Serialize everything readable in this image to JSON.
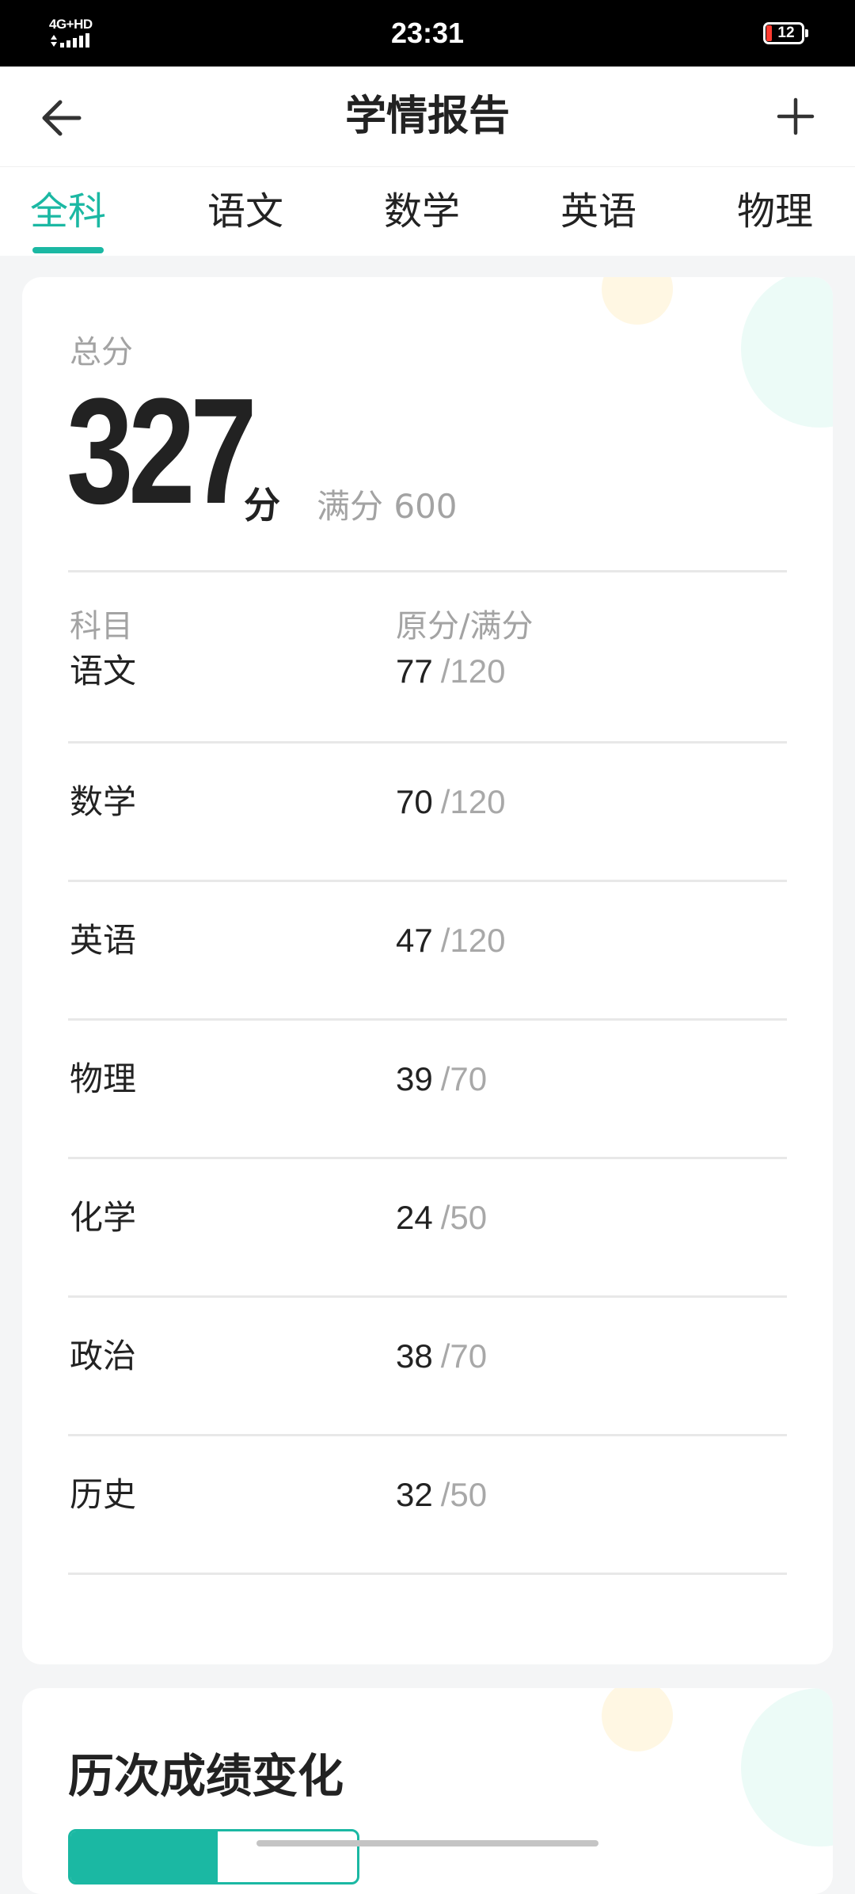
{
  "status_bar": {
    "network": "4G+HD",
    "time": "23:31",
    "battery": "12",
    "battery_color": "#ff3b30"
  },
  "header": {
    "title": "学情报告",
    "back_icon": "arrow-left-icon",
    "add_icon": "plus-icon"
  },
  "tabs": [
    {
      "label": "全科",
      "active": true
    },
    {
      "label": "语文",
      "active": false
    },
    {
      "label": "数学",
      "active": false
    },
    {
      "label": "英语",
      "active": false
    },
    {
      "label": "物理",
      "active": false
    }
  ],
  "accent_color": "#1bb8a3",
  "score_card": {
    "total_label": "总分",
    "total_score": "327",
    "total_unit": "分",
    "full_mark_label": "满分 600",
    "col_subject": "科目",
    "col_score": "原分/满分",
    "subjects": [
      {
        "name": "语文",
        "score": "77",
        "full": "/120"
      },
      {
        "name": "数学",
        "score": "70",
        "full": "/120"
      },
      {
        "name": "英语",
        "score": "47",
        "full": "/120"
      },
      {
        "name": "物理",
        "score": "39",
        "full": "/70"
      },
      {
        "name": "化学",
        "score": "24",
        "full": "/50"
      },
      {
        "name": "政治",
        "score": "38",
        "full": "/70"
      },
      {
        "name": "历史",
        "score": "32",
        "full": "/50"
      }
    ]
  },
  "history_card": {
    "title": "历次成绩变化"
  }
}
